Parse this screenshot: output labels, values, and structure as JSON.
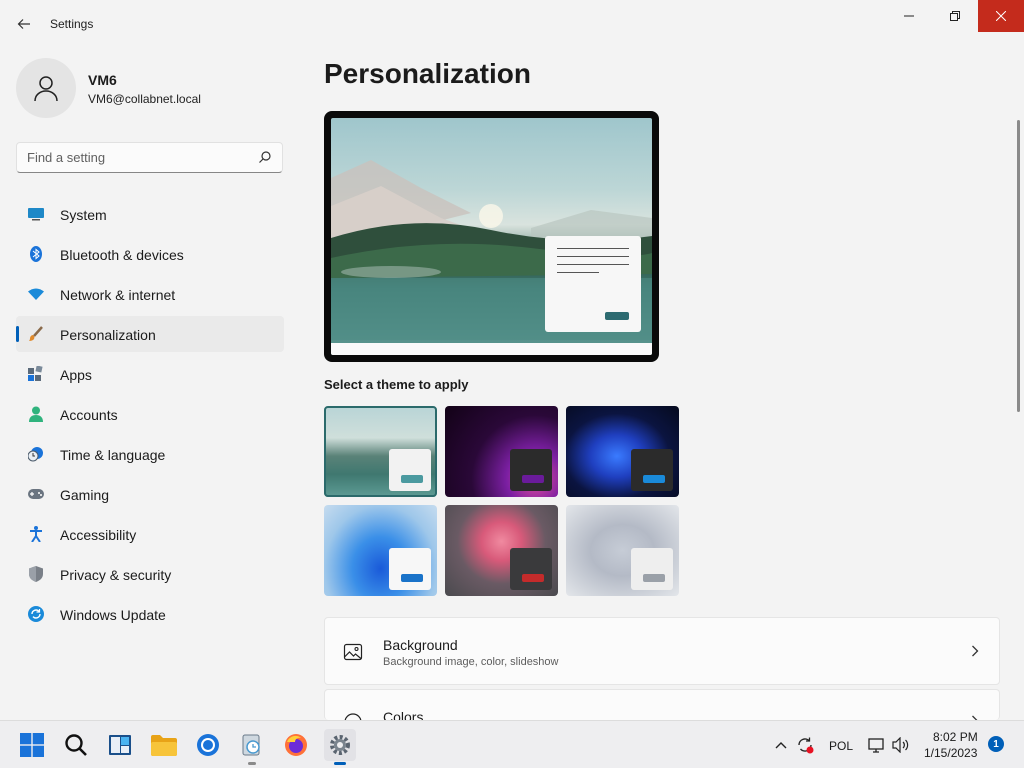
{
  "window": {
    "title": "Settings",
    "minimize": "—",
    "maximize": "▢",
    "close": "✕"
  },
  "user": {
    "name": "VM6",
    "email": "VM6@collabnet.local"
  },
  "search": {
    "placeholder": "Find a setting"
  },
  "nav": {
    "items": [
      {
        "label": "System",
        "icon": "system-icon"
      },
      {
        "label": "Bluetooth & devices",
        "icon": "bluetooth-icon"
      },
      {
        "label": "Network & internet",
        "icon": "wifi-icon"
      },
      {
        "label": "Personalization",
        "icon": "brush-icon",
        "selected": true
      },
      {
        "label": "Apps",
        "icon": "apps-icon"
      },
      {
        "label": "Accounts",
        "icon": "accounts-icon"
      },
      {
        "label": "Time & language",
        "icon": "clock-globe-icon"
      },
      {
        "label": "Gaming",
        "icon": "gamepad-icon"
      },
      {
        "label": "Accessibility",
        "icon": "accessibility-icon"
      },
      {
        "label": "Privacy & security",
        "icon": "shield-icon"
      },
      {
        "label": "Windows Update",
        "icon": "update-icon"
      }
    ]
  },
  "main": {
    "title": "Personalization",
    "themes_label": "Select a theme to apply",
    "cards": [
      {
        "title": "Background",
        "subtitle": "Background image, color, slideshow",
        "icon": "image-icon"
      },
      {
        "title": "Colors",
        "subtitle": "",
        "icon": "palette-icon"
      }
    ]
  },
  "taskbar": {
    "language": "POL",
    "time": "8:02 PM",
    "date": "1/15/2023",
    "notifications": "1"
  },
  "colors": {
    "accent": "#005fb8",
    "close": "#c42b1c",
    "theme_selected": "#2b6a6b"
  }
}
